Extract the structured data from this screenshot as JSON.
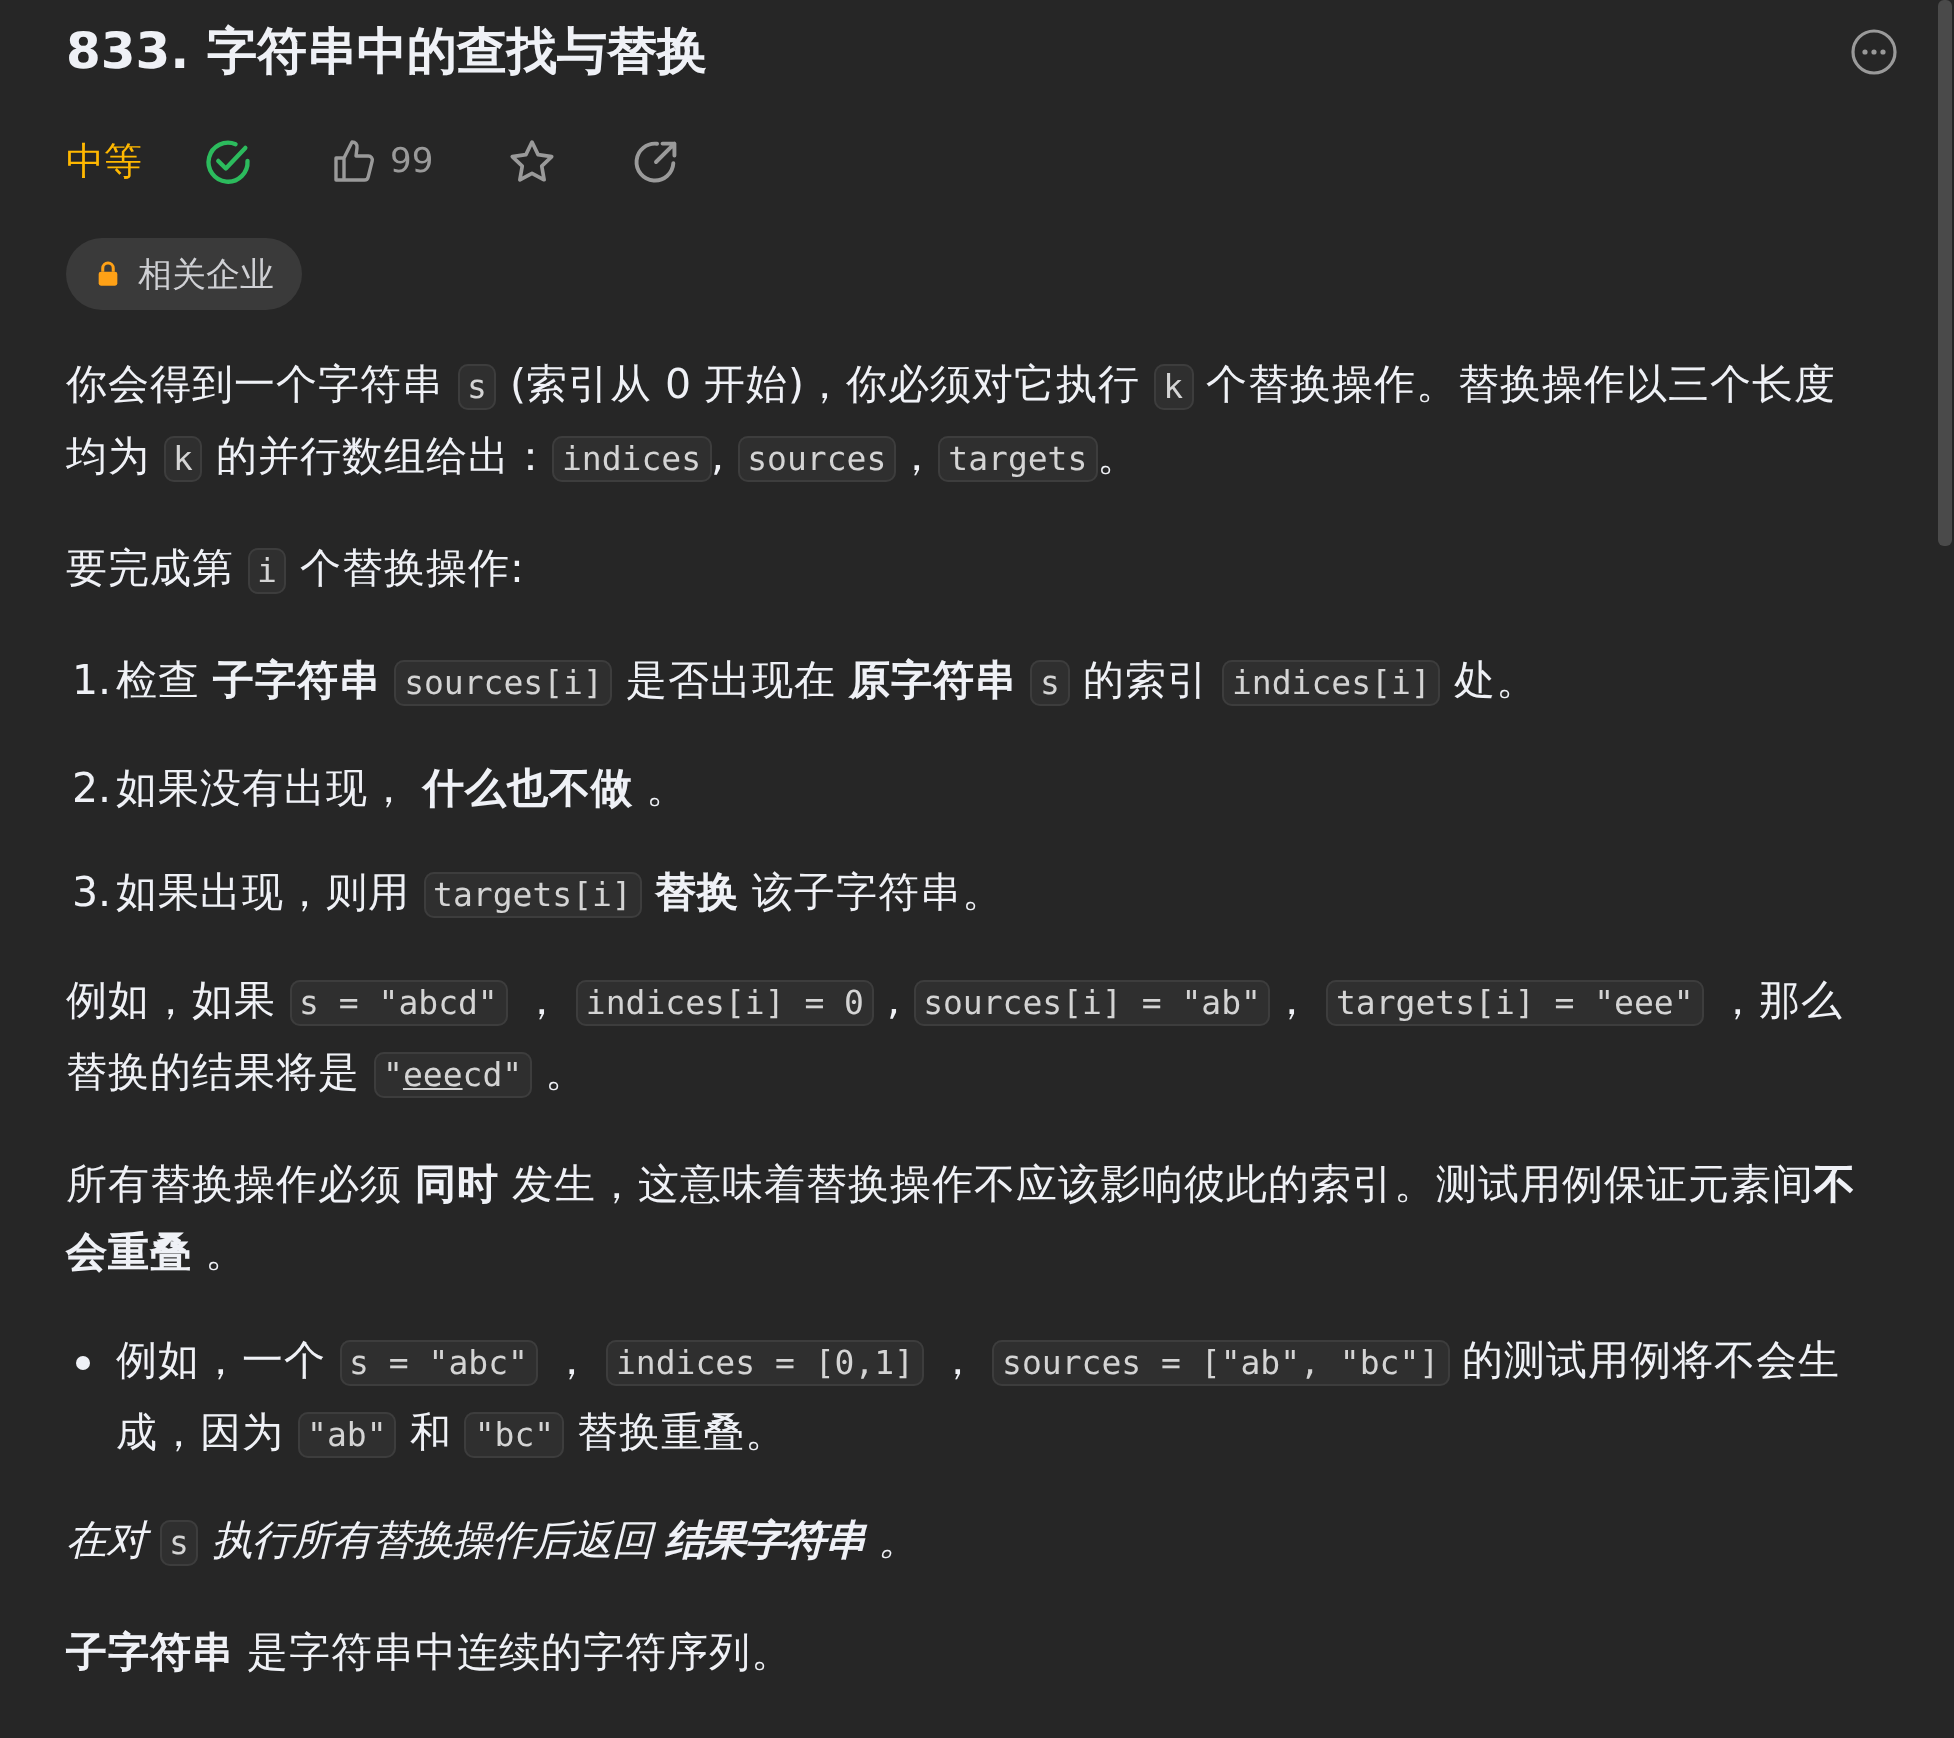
{
  "title": "833. 字符串中的查找与替换",
  "meta": {
    "difficulty": "中等",
    "solved": true,
    "likes": "99",
    "starred": false
  },
  "tags": [
    {
      "label": "相关企业",
      "locked": true
    }
  ],
  "blocks": [
    {
      "kind": "paragraph",
      "italic": false,
      "segments": [
        {
          "kind": "text",
          "text": "你会得到一个字符串 "
        },
        {
          "kind": "code",
          "text": "s"
        },
        {
          "kind": "text",
          "text": " (索引从 0 开始)，你必须对它执行 "
        },
        {
          "kind": "code",
          "text": "k"
        },
        {
          "kind": "text",
          "text": " 个替换操作。替换操作以三个长度均为 "
        },
        {
          "kind": "code",
          "text": "k"
        },
        {
          "kind": "text",
          "text": " 的并行数组给出："
        },
        {
          "kind": "code",
          "text": "indices"
        },
        {
          "kind": "text",
          "text": ", "
        },
        {
          "kind": "code",
          "text": "sources"
        },
        {
          "kind": "text",
          "text": "，"
        },
        {
          "kind": "code",
          "text": "targets"
        },
        {
          "kind": "text",
          "text": "。"
        }
      ]
    },
    {
      "kind": "paragraph",
      "italic": false,
      "segments": [
        {
          "kind": "text",
          "text": "要完成第 "
        },
        {
          "kind": "code",
          "text": "i"
        },
        {
          "kind": "text",
          "text": " 个替换操作:"
        }
      ]
    },
    {
      "kind": "ordered",
      "number": "1.",
      "segments": [
        {
          "kind": "text",
          "text": "检查 **子字符串** "
        },
        {
          "kind": "code",
          "text": "sources[i]"
        },
        {
          "kind": "text",
          "text": " 是否出现在 **原字符串** "
        },
        {
          "kind": "code",
          "text": "s"
        },
        {
          "kind": "text",
          "text": " 的索引 "
        },
        {
          "kind": "code",
          "text": "indices[i]"
        },
        {
          "kind": "text",
          "text": " 处。"
        }
      ]
    },
    {
      "kind": "ordered",
      "number": "2.",
      "segments": [
        {
          "kind": "text",
          "text": "如果没有出现， **什么也不做** 。"
        }
      ]
    },
    {
      "kind": "ordered",
      "number": "3.",
      "segments": [
        {
          "kind": "text",
          "text": "如果出现，则用 "
        },
        {
          "kind": "code",
          "text": "targets[i]"
        },
        {
          "kind": "text",
          "text": " **替换** 该子字符串。"
        }
      ]
    },
    {
      "kind": "paragraph",
      "italic": false,
      "segments": [
        {
          "kind": "text",
          "text": "例如，如果 "
        },
        {
          "kind": "code",
          "text": "s = \"abcd\""
        },
        {
          "kind": "text",
          "text": " ， "
        },
        {
          "kind": "code",
          "text": "indices[i] = 0"
        },
        {
          "kind": "text",
          "text": " , "
        },
        {
          "kind": "code",
          "text": "sources[i] = \"ab\""
        },
        {
          "kind": "text",
          "text": "， "
        },
        {
          "kind": "code",
          "text": "targets[i] = \"eee\""
        },
        {
          "kind": "text",
          "text": " ，那么替换的结果将是 "
        },
        {
          "kind": "code",
          "parts": [
            {
              "text": "\"",
              "underlined": false
            },
            {
              "text": "eee",
              "underlined": true
            },
            {
              "text": "cd\"",
              "underlined": false
            }
          ]
        },
        {
          "kind": "text",
          "text": " 。"
        }
      ]
    },
    {
      "kind": "paragraph",
      "italic": false,
      "segments": [
        {
          "kind": "text",
          "text": "所有替换操作必须 **同时** 发生，这意味着替换操作不应该影响彼此的索引。测试用例保证元素间**不会重叠** 。"
        }
      ]
    },
    {
      "kind": "bullet",
      "segments": [
        {
          "kind": "text",
          "text": "例如，一个 "
        },
        {
          "kind": "code",
          "text": "s = \"abc\""
        },
        {
          "kind": "text",
          "text": " ， "
        },
        {
          "kind": "code",
          "text": "indices = [0,1]"
        },
        {
          "kind": "text",
          "text": " ， "
        },
        {
          "kind": "code",
          "text": "sources = [\"ab\", \"bc\"]"
        },
        {
          "kind": "text",
          "text": " 的测试用例将不会生成，因为 "
        },
        {
          "kind": "code",
          "text": "\"ab\""
        },
        {
          "kind": "text",
          "text": " 和 "
        },
        {
          "kind": "code",
          "text": "\"bc\""
        },
        {
          "kind": "text",
          "text": " 替换重叠。"
        }
      ]
    },
    {
      "kind": "paragraph",
      "italic": true,
      "segments": [
        {
          "kind": "text",
          "text": "在对 "
        },
        {
          "kind": "code",
          "text": "s"
        },
        {
          "kind": "text",
          "text": " 执行所有替换操作后返回 **结果字符串** 。"
        }
      ]
    },
    {
      "kind": "paragraph",
      "italic": false,
      "segments": [
        {
          "kind": "text",
          "text": "**子字符串** 是字符串中连续的字符序列。"
        }
      ]
    }
  ]
}
